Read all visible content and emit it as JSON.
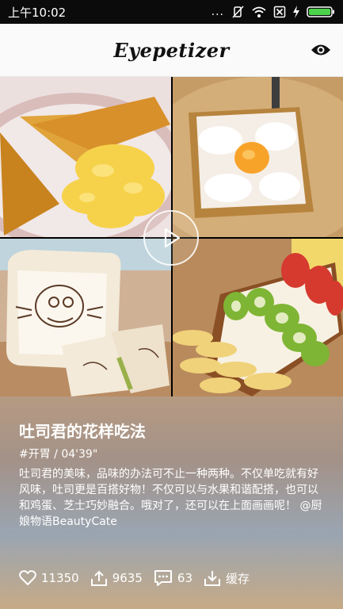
{
  "status_bar": {
    "time": "上午10:02",
    "dots": "..."
  },
  "header": {
    "title": "Eyepetizer"
  },
  "video": {
    "title": "吐司君的花样吃法",
    "meta": "#开胃 / 04'39\"",
    "description": "吐司君的美味，品味的办法可不止一种两种。不仅单吃就有好风味，吐司更是百搭好物！不仅可以与水果和谐配搭，也可以和鸡蛋、芝士巧妙融合。哦对了，还可以在上面画画呢！ @厨娘物语BeautyCate"
  },
  "actions": {
    "likes": "11350",
    "shares": "9635",
    "comments": "63",
    "cache_label": "缓存"
  },
  "icons": {
    "eye": "eye-icon",
    "play": "play-icon",
    "heart": "heart-icon",
    "share": "share-icon",
    "comment": "comment-icon",
    "download": "download-icon"
  }
}
